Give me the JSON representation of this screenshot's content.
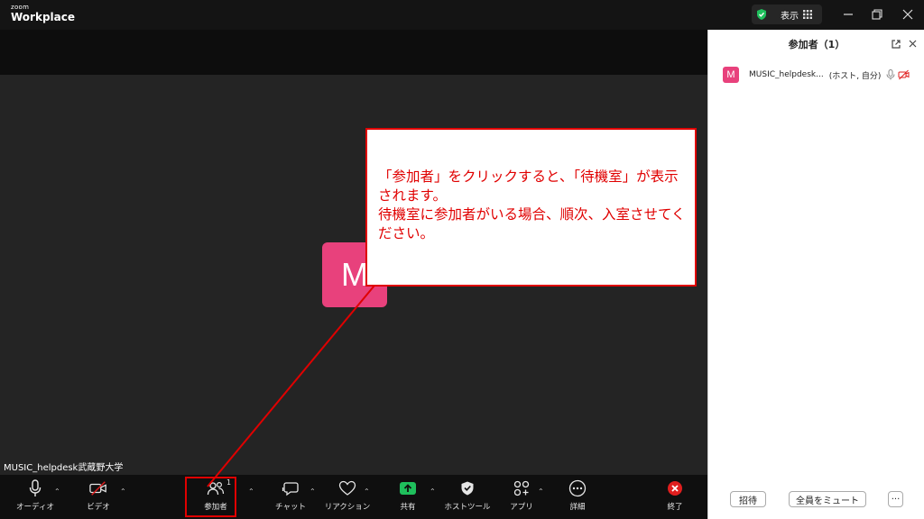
{
  "titlebar": {
    "logo_small": "zoom",
    "logo_big": "Workplace",
    "view_label": "表示"
  },
  "meeting": {
    "avatar_letter": "M",
    "self_name": "MUSIC_helpdesk武蔵野大学"
  },
  "toolbar": {
    "audio": "オーディオ",
    "video": "ビデオ",
    "participants": "参加者",
    "participants_count": "1",
    "chat": "チャット",
    "reactions": "リアクション",
    "share": "共有",
    "host_tools": "ホストツール",
    "apps": "アプリ",
    "more": "詳細",
    "end": "終了"
  },
  "panel": {
    "title": "参加者（1）",
    "participant": {
      "avatar_letter": "M",
      "name": "MUSIC_helpdesk...",
      "tag": "(ホスト, 自分)"
    },
    "invite": "招待",
    "mute_all": "全員をミュート",
    "more": "···"
  },
  "annotation": {
    "text": "「参加者」をクリックすると、「待機室」が表示されます。\n待機室に参加者がいる場合、順次、入室させてください。"
  },
  "colors": {
    "accent_red": "#e00000",
    "avatar_pink": "#e8417c",
    "share_green": "#1fbf5c"
  }
}
